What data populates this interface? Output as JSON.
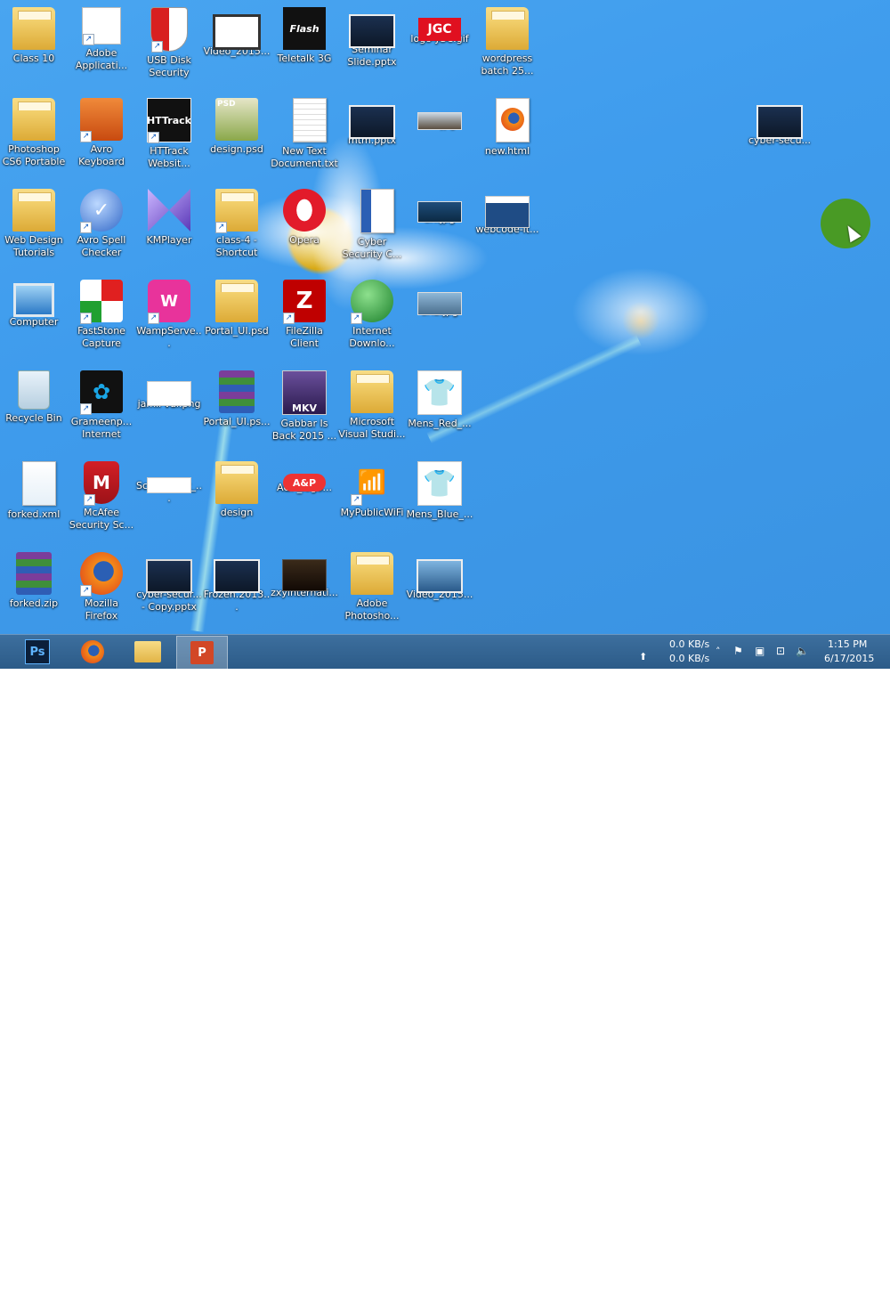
{
  "desktop_icons": [
    {
      "label": "Class 10"
    },
    {
      "label": "Adobe\nApplicati..."
    },
    {
      "label": "USB Disk\nSecurity"
    },
    {
      "label": "Video_2015..."
    },
    {
      "label": "Teletalk 3G"
    },
    {
      "label": "Seminar\nSlide.pptx"
    },
    {
      "label": "logo-JGC.gif"
    },
    {
      "label": "wordpress\nbatch 25..."
    },
    {
      "label": "Photoshop\nCS6 Portable"
    },
    {
      "label": "Avro\nKeyboard"
    },
    {
      "label": "HTTrack\nWebsit..."
    },
    {
      "label": "design.psd"
    },
    {
      "label": "New Text\nDocument.txt"
    },
    {
      "label": "mtm.pptx"
    },
    {
      "label": "sur.jpg"
    },
    {
      "label": "new.html"
    },
    {
      "label": "cyber-secu..."
    },
    {
      "label": "Web Design\nTutorials"
    },
    {
      "label": "Avro Spell\nChecker"
    },
    {
      "label": "KMPlayer"
    },
    {
      "label": "class-4 -\nShortcut"
    },
    {
      "label": "Opera"
    },
    {
      "label": "Cyber\nSecurity C..."
    },
    {
      "label": "url.jpg"
    },
    {
      "label": "webcode-it..."
    },
    {
      "label": "Computer"
    },
    {
      "label": "FastStone\nCapture"
    },
    {
      "label": "WampServe..."
    },
    {
      "label": "Portal_UI.psd"
    },
    {
      "label": "FileZilla Client"
    },
    {
      "label": "Internet\nDownlo..."
    },
    {
      "label": "url2.jpg"
    },
    {
      "label": "Recycle Bin"
    },
    {
      "label": "Grameenp...\nInternet"
    },
    {
      "label": "jamil vai.png"
    },
    {
      "label": "Portal_UI.ps..."
    },
    {
      "label": "Gabbar Is\nBack 2015 ..."
    },
    {
      "label": "Microsoft\nVisual Studi..."
    },
    {
      "label": "Mens_Red_..."
    },
    {
      "label": "forked.xml"
    },
    {
      "label": "McAfee\nSecurity Sc..."
    },
    {
      "label": "Screenshot_..."
    },
    {
      "label": "design"
    },
    {
      "label": "A&P_logo..."
    },
    {
      "label": "MyPublicWiFi"
    },
    {
      "label": "Mens_Blue_..."
    },
    {
      "label": "forked.zip"
    },
    {
      "label": "Mozilla\nFirefox"
    },
    {
      "label": "cyber-secur...\n- Copy.pptx"
    },
    {
      "label": "Frozen.2013..."
    },
    {
      "label": "zxyinternati..."
    },
    {
      "label": "Adobe\nPhotosho..."
    },
    {
      "label": "Video_2015..."
    }
  ],
  "glyphs": {
    "teletalk": "Flash",
    "jgc": "JGC",
    "httrack": "HTTrack",
    "mkv": "MKV",
    "ap": "A&P",
    "ps": "Ps",
    "psd": "PSD"
  },
  "taskbar": {
    "apps": [
      {
        "name": "Photoshop"
      },
      {
        "name": "Firefox"
      },
      {
        "name": "File Explorer"
      },
      {
        "name": "PowerPoint"
      }
    ],
    "net_down": "0.0 KB/s",
    "net_up": "0.0 KB/s",
    "time": "1:15 PM",
    "date": "6/17/2015"
  },
  "colors": {
    "desktop_bg": "#3f9ced",
    "taskbar_bg": "#2c5b88",
    "cursor_halo": "#4a9a1a"
  }
}
